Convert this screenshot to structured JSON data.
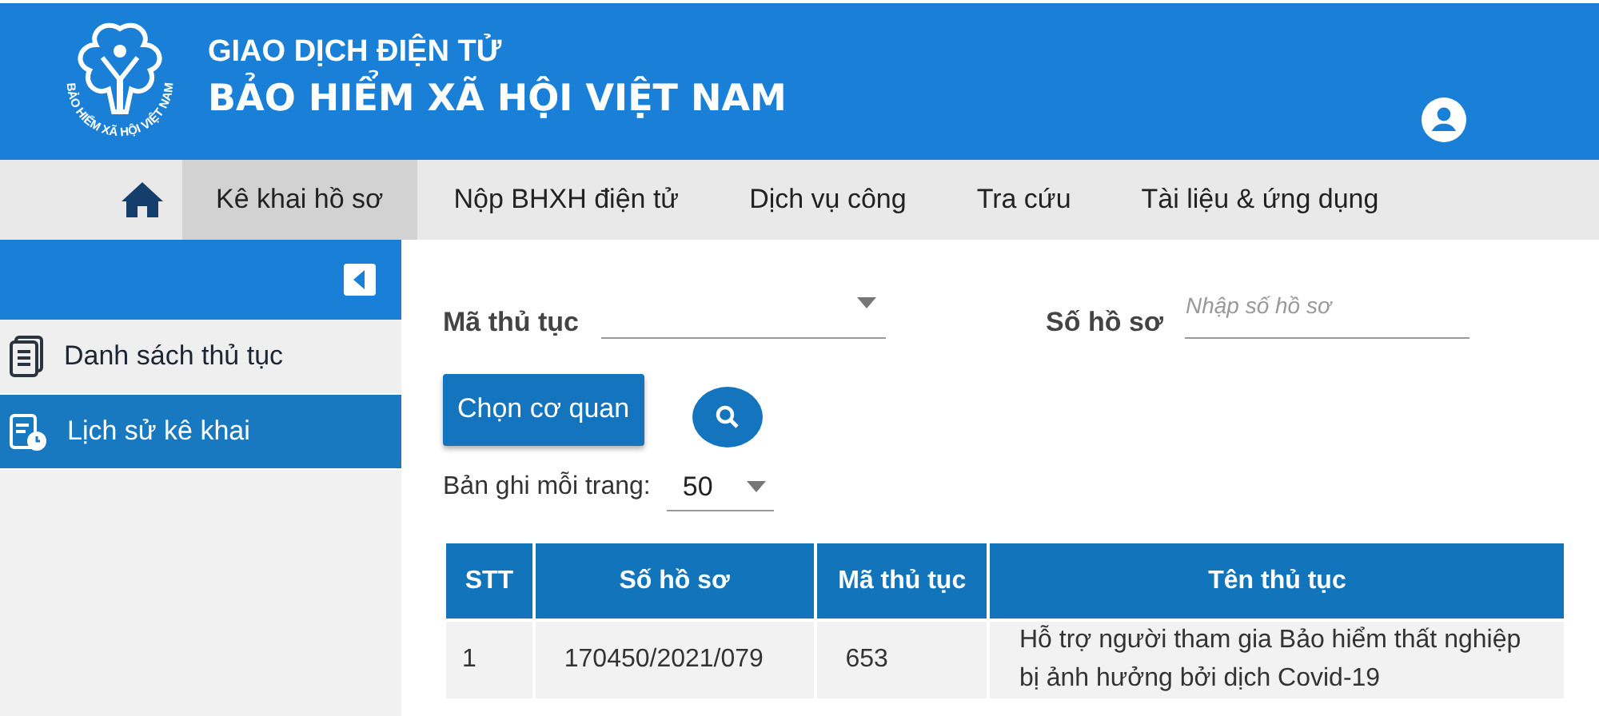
{
  "header": {
    "logo_ring_text": "BẢO HIỂM XÃ HỘI VIỆT NAM",
    "subtitle": "GIAO DỊCH ĐIỆN TỬ",
    "title": "BẢO HIỂM XÃ HỘI VIỆT NAM"
  },
  "nav": [
    {
      "label": "Kê khai hồ sơ",
      "selected": true
    },
    {
      "label": "Nộp BHXH điện tử",
      "selected": false
    },
    {
      "label": "Dịch vụ công",
      "selected": false
    },
    {
      "label": "Tra cứu",
      "selected": false
    },
    {
      "label": "Tài liệu & ứng dụng",
      "selected": false
    }
  ],
  "sidebar": {
    "items": [
      {
        "label": "Danh sách thủ tục",
        "kind": "list",
        "selected": false
      },
      {
        "label": "Lịch sử kê khai",
        "kind": "history",
        "selected": true
      }
    ]
  },
  "form": {
    "procedure_label": "Mã thủ tục",
    "record_label": "Số hồ sơ",
    "record_placeholder": "Nhập số hồ sơ",
    "agency_button": "Chọn cơ quan",
    "per_page_label": "Bản ghi mỗi trang:",
    "per_page_value": "50"
  },
  "table": {
    "columns": [
      "STT",
      "Số hồ sơ",
      "Mã thủ tục",
      "Tên thủ tục"
    ],
    "rows": [
      [
        "1",
        "170450/2021/079",
        "653",
        "Hỗ trợ người tham gia Bảo hiểm thất nghiệp bị ảnh hưởng bởi dịch Covid-19"
      ]
    ]
  }
}
